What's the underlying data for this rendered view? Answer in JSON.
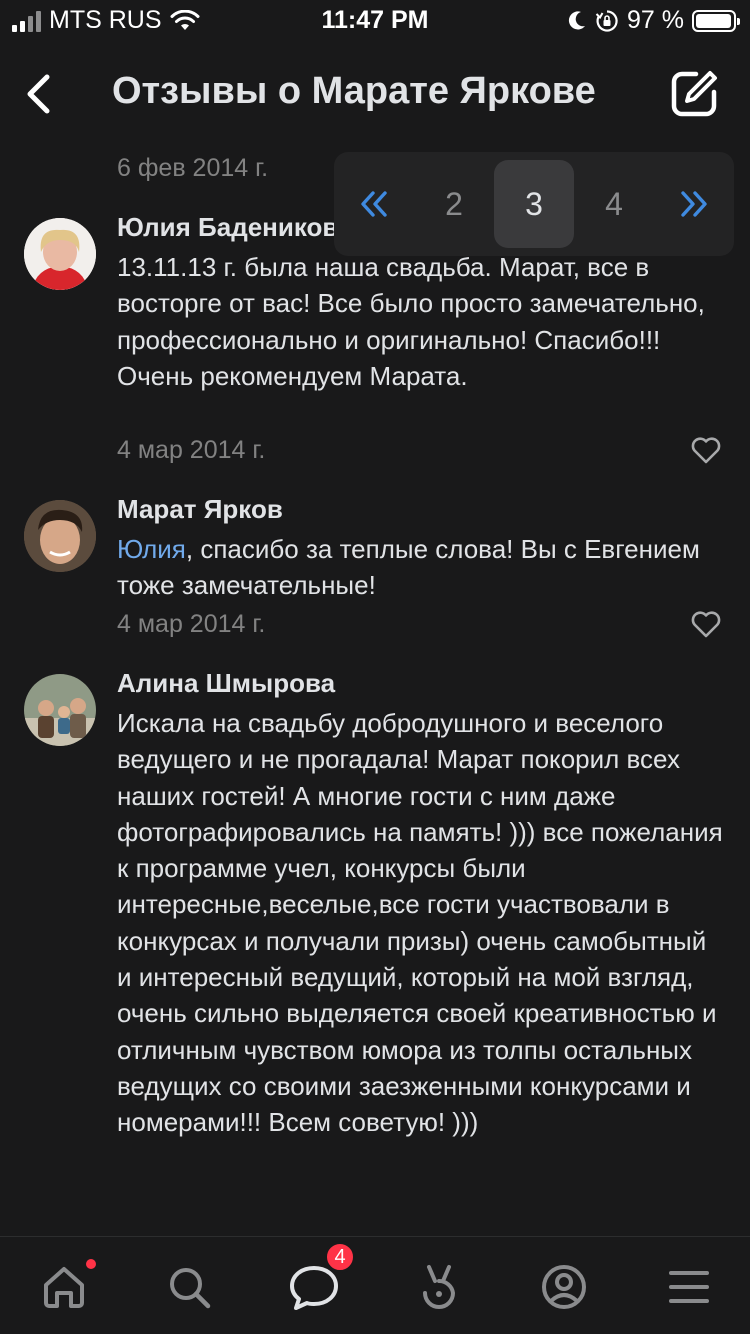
{
  "status_bar": {
    "carrier": "MTS RUS",
    "time": "11:47 PM",
    "battery": "97 %",
    "battery_level": 0.97
  },
  "header": {
    "title": "Отзывы о Марате Яркове"
  },
  "top_date": "6 фев 2014 г.",
  "pagination": {
    "pages": [
      "2",
      "3",
      "4"
    ],
    "current": "3"
  },
  "comments": [
    {
      "author": "Юлия Бадениковa",
      "text": "13.11.13 г. была наша свадьба. Марат,  все в восторге от вас!  Все было просто замечательно, профессионально и оригинально! Спасибо!!! Очень рекомендуем Марата.",
      "date": "4 мар 2014 г."
    },
    {
      "author": "Марат Ярков",
      "mention": "Юлия",
      "text": ", спасибо за теплые слова! Вы с Евгением тоже замечательные!",
      "date": "4 мар 2014 г."
    },
    {
      "author": "Алина Шмырова",
      "text": "Искала на свадьбу добродушного и веселого ведущего и не прогадала! Марат покорил всех наших гостей! А многие гости с ним даже фотографировались на память! ))) все пожелания к программе учел, конкурсы были интересные,веселые,все гости участвовали в конкурсах и получали призы) очень самобытный и интересный ведущий, который на мой взгляд, очень сильно выделяется своей креативностью и отличным чувством юмора из толпы остальных ведущих со своими заезженными конкурсами и номерами!!! Всем советую! )))"
    }
  ],
  "tabbar": {
    "items": [
      "home-icon",
      "search-icon",
      "messages-icon",
      "clips-icon",
      "profile-icon",
      "menu-icon"
    ],
    "messages_badge": "4"
  },
  "colors": {
    "background": "#19191a",
    "text": "#e1e3e6",
    "secondary": "#828282",
    "accent": "#71aaeb",
    "badge": "#ff3347"
  }
}
